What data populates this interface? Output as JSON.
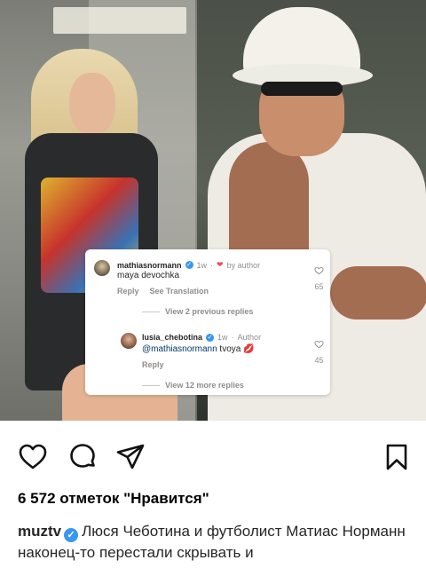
{
  "post": {
    "image_alt": "Two photos side by side: a woman in an elevator and a man in a white bucket hat",
    "likes_text": "6 572 отметок \"Нравится\"",
    "caption_user": "muztv",
    "caption_text": "Люся Чеботина и футболист Матиас Норманн наконец-то перестали скрывать и"
  },
  "comments": [
    {
      "username": "mathiasnormann",
      "time": "1w",
      "badge": "by author",
      "text": "maya devochka",
      "reply_label": "Reply",
      "translate_label": "See Translation",
      "likes": "65",
      "view_replies": "View 2 previous replies"
    },
    {
      "username": "lusia_chebotina",
      "time": "1w",
      "badge": "Author",
      "mention": "@mathiasnormann",
      "text": "tvoya",
      "emoji": "💋",
      "reply_label": "Reply",
      "likes": "45",
      "view_replies": "View 12 more replies"
    }
  ],
  "icons": {
    "verified": "✓",
    "heart_red": "❤"
  },
  "colors": {
    "verified_blue": "#3897f0",
    "link_blue": "#00376b",
    "muted": "#8e8e8e"
  }
}
